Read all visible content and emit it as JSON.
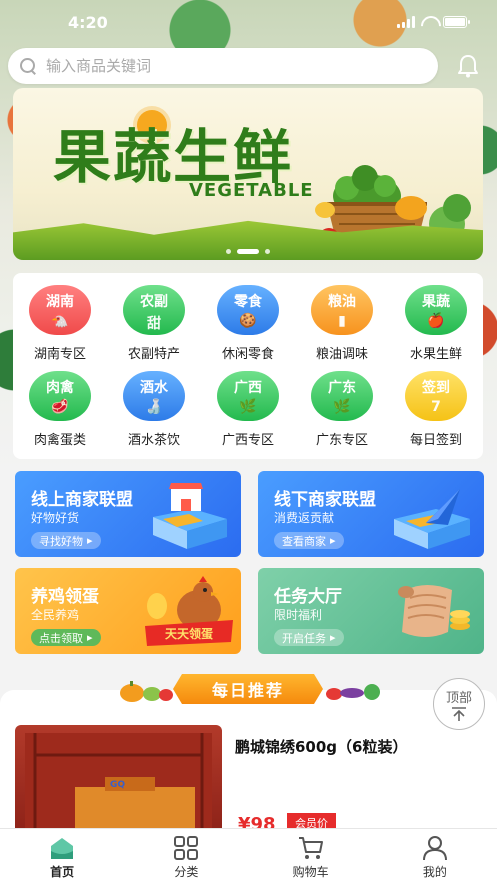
{
  "status_bar": {
    "time": "4:20"
  },
  "search": {
    "placeholder": "输入商品关键词"
  },
  "banner": {
    "title": "果蔬生鲜",
    "subtitle": "VEGETABLE"
  },
  "categories": [
    {
      "badge": "湖南",
      "glyph": "🐔",
      "label": "湖南专区",
      "color": "red"
    },
    {
      "badge": "农副",
      "glyph": "甜",
      "label": "农副特产",
      "color": "green"
    },
    {
      "badge": "零食",
      "glyph": "🍪",
      "label": "休闲零食",
      "color": "blue"
    },
    {
      "badge": "粮油",
      "glyph": "▮",
      "label": "粮油调味",
      "color": "orange"
    },
    {
      "badge": "果蔬",
      "glyph": "🍎",
      "label": "水果生鲜",
      "color": "green"
    },
    {
      "badge": "肉禽",
      "glyph": "🥩",
      "label": "肉禽蛋类",
      "color": "green"
    },
    {
      "badge": "酒水",
      "glyph": "🍶",
      "label": "酒水茶饮",
      "color": "blue"
    },
    {
      "badge": "广西",
      "glyph": "🌿",
      "label": "广西专区",
      "color": "green"
    },
    {
      "badge": "广东",
      "glyph": "🌿",
      "label": "广东专区",
      "color": "green"
    },
    {
      "badge": "签到",
      "glyph": "7",
      "label": "每日签到",
      "color": "yellow"
    }
  ],
  "promos": {
    "online": {
      "title": "线上商家联盟",
      "subtitle": "好物好货",
      "button": "寻找好物"
    },
    "offline": {
      "title": "线下商家联盟",
      "subtitle": "消费返贡献",
      "button": "查看商家"
    },
    "eggs": {
      "title": "养鸡领蛋",
      "subtitle": "全民养鸡",
      "button": "点击领取",
      "art_label": "天天领蛋"
    },
    "tasks": {
      "title": "任务大厅",
      "subtitle": "限时福利",
      "button": "开启任务"
    }
  },
  "recommend": {
    "heading": "每日推荐",
    "product": {
      "name": "鹏城锦绣600g（6粒装）",
      "price": "¥98",
      "tag": "会员价"
    }
  },
  "back_top": {
    "label": "顶部"
  },
  "tabbar": [
    {
      "label": "首页",
      "icon": "home-icon",
      "active": true
    },
    {
      "label": "分类",
      "icon": "grid-icon",
      "active": false
    },
    {
      "label": "购物车",
      "icon": "cart-icon",
      "active": false
    },
    {
      "label": "我的",
      "icon": "user-icon",
      "active": false
    }
  ]
}
